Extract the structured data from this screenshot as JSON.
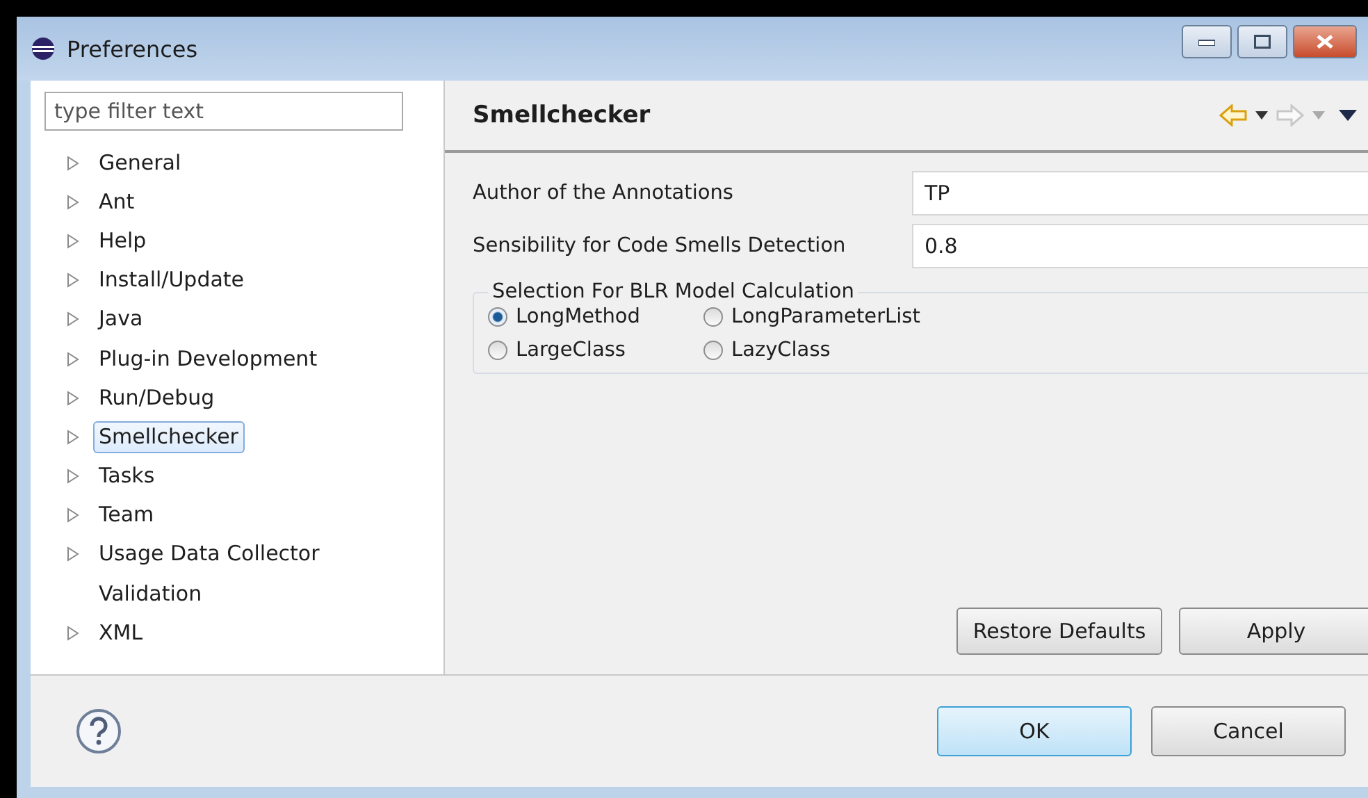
{
  "window": {
    "title": "Preferences"
  },
  "filter": {
    "placeholder": "type filter text"
  },
  "tree": [
    {
      "label": "General",
      "expandable": true,
      "selected": false
    },
    {
      "label": "Ant",
      "expandable": true,
      "selected": false
    },
    {
      "label": "Help",
      "expandable": true,
      "selected": false
    },
    {
      "label": "Install/Update",
      "expandable": true,
      "selected": false
    },
    {
      "label": "Java",
      "expandable": true,
      "selected": false
    },
    {
      "label": "Plug-in Development",
      "expandable": true,
      "selected": false
    },
    {
      "label": "Run/Debug",
      "expandable": true,
      "selected": false
    },
    {
      "label": "Smellchecker",
      "expandable": true,
      "selected": true
    },
    {
      "label": "Tasks",
      "expandable": true,
      "selected": false
    },
    {
      "label": "Team",
      "expandable": true,
      "selected": false
    },
    {
      "label": "Usage Data Collector",
      "expandable": true,
      "selected": false
    },
    {
      "label": "Validation",
      "expandable": false,
      "selected": false
    },
    {
      "label": "XML",
      "expandable": true,
      "selected": false
    }
  ],
  "page": {
    "title": "Smellchecker",
    "fields": [
      {
        "label": "Author of the Annotations",
        "value": "TP"
      },
      {
        "label": "Sensibility for Code Smells Detection",
        "value": "0.8"
      }
    ],
    "group": {
      "title": "Selection For BLR Model Calculation",
      "options": [
        {
          "label": "LongMethod",
          "selected": true
        },
        {
          "label": "LongParameterList",
          "selected": false
        },
        {
          "label": "LargeClass",
          "selected": false
        },
        {
          "label": "LazyClass",
          "selected": false
        }
      ]
    },
    "buttons": [
      "Restore Defaults",
      "Apply"
    ]
  },
  "footer": {
    "buttons": [
      {
        "label": "OK",
        "default": true
      },
      {
        "label": "Cancel",
        "default": false
      }
    ]
  }
}
